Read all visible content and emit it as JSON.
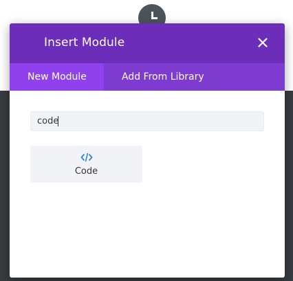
{
  "modal": {
    "title": "Insert Module",
    "close_icon": "close-icon"
  },
  "tabs": [
    {
      "label": "New Module",
      "active": true
    },
    {
      "label": "Add From Library",
      "active": false
    }
  ],
  "search": {
    "value": "code",
    "placeholder": ""
  },
  "modules": [
    {
      "label": "Code",
      "icon": "code-icon"
    }
  ],
  "colors": {
    "header": "#6c2eb9",
    "tabs_bar": "#7e3bd0",
    "active_tab": "#8f42ec",
    "icon_accent": "#2b87da",
    "backdrop": "#373c41",
    "add_button": "#4d5459"
  }
}
